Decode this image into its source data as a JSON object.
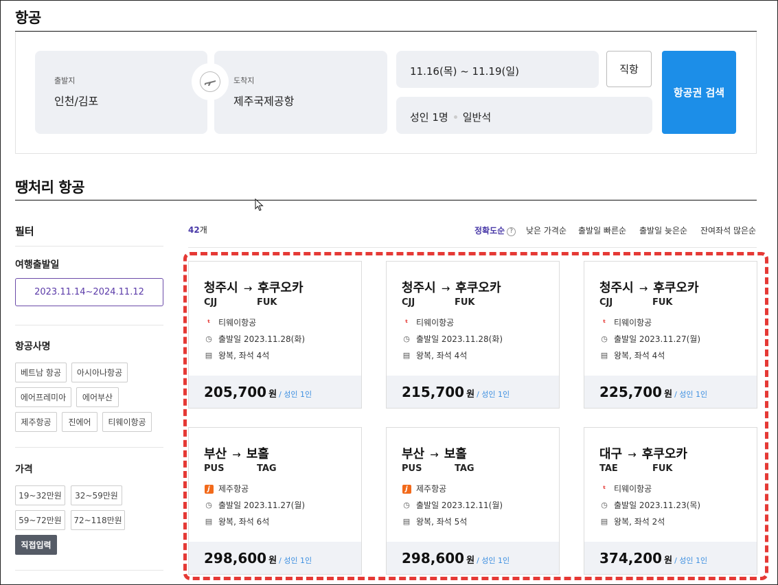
{
  "flight_section": {
    "title": "항공",
    "departure": {
      "label": "출발지",
      "value": "인천/김포"
    },
    "arrival": {
      "label": "도착지",
      "value": "제주국제공항"
    },
    "dates": "11.16(목) ~ 11.19(일)",
    "passengers": "성인 1명",
    "seat_class": "일반석",
    "direct_label": "직항",
    "search_label": "항공권 검색"
  },
  "deal_section": {
    "title": "땡처리 항공",
    "count_number": "42",
    "count_unit": "개",
    "sorts": [
      "정확도순",
      "낮은 가격순",
      "출발일 빠른순",
      "출발일 늦은순",
      "잔여좌석 많은순"
    ],
    "active_sort": "정확도순"
  },
  "filters": {
    "title": "필터",
    "travel_date": {
      "label": "여행출발일",
      "value": "2023.11.14~2024.11.12"
    },
    "airlines": {
      "label": "항공사명",
      "options": [
        "베트남 항공",
        "아시아나항공",
        "에어프레미아",
        "에어부산",
        "제주항공",
        "진에어",
        "티웨이항공"
      ]
    },
    "price": {
      "label": "가격",
      "options": [
        "19~32만원",
        "32~59만원",
        "59~72만원",
        "72~118만원"
      ],
      "custom_label": "직접입력"
    }
  },
  "cards": [
    {
      "from": "청주시",
      "to": "후쿠오카",
      "from_code": "CJJ",
      "to_code": "FUK",
      "airline": "티웨이항공",
      "airline_icon": "tway-logo-icon",
      "departure": "출발일 2023.11.28(화)",
      "seats": "왕복, 좌석 4석",
      "price": "205,700",
      "won": "원",
      "pax": "/ 성인 1인"
    },
    {
      "from": "청주시",
      "to": "후쿠오카",
      "from_code": "CJJ",
      "to_code": "FUK",
      "airline": "티웨이항공",
      "airline_icon": "tway-logo-icon",
      "departure": "출발일 2023.11.28(화)",
      "seats": "왕복, 좌석 4석",
      "price": "215,700",
      "won": "원",
      "pax": "/ 성인 1인"
    },
    {
      "from": "청주시",
      "to": "후쿠오카",
      "from_code": "CJJ",
      "to_code": "FUK",
      "airline": "티웨이항공",
      "airline_icon": "tway-logo-icon",
      "departure": "출발일 2023.11.27(월)",
      "seats": "왕복, 좌석 4석",
      "price": "225,700",
      "won": "원",
      "pax": "/ 성인 1인"
    },
    {
      "from": "부산",
      "to": "보홀",
      "from_code": "PUS",
      "to_code": "TAG",
      "airline": "제주항공",
      "airline_icon": "jejuair-logo-icon",
      "departure": "출발일 2023.11.27(월)",
      "seats": "왕복, 좌석 6석",
      "price": "298,600",
      "won": "원",
      "pax": "/ 성인 1인"
    },
    {
      "from": "부산",
      "to": "보홀",
      "from_code": "PUS",
      "to_code": "TAG",
      "airline": "제주항공",
      "airline_icon": "jejuair-logo-icon",
      "departure": "출발일 2023.12.11(월)",
      "seats": "왕복, 좌석 5석",
      "price": "298,600",
      "won": "원",
      "pax": "/ 성인 1인"
    },
    {
      "from": "대구",
      "to": "후쿠오카",
      "from_code": "TAE",
      "to_code": "FUK",
      "airline": "티웨이항공",
      "airline_icon": "tway-logo-icon",
      "departure": "출발일 2023.11.23(목)",
      "seats": "왕복, 좌석 2석",
      "price": "374,200",
      "won": "원",
      "pax": "/ 성인 1인"
    }
  ],
  "colors": {
    "accent_blue": "#1c8ee8",
    "accent_purple": "#4a3aa8",
    "highlight_red": "#e53935"
  }
}
